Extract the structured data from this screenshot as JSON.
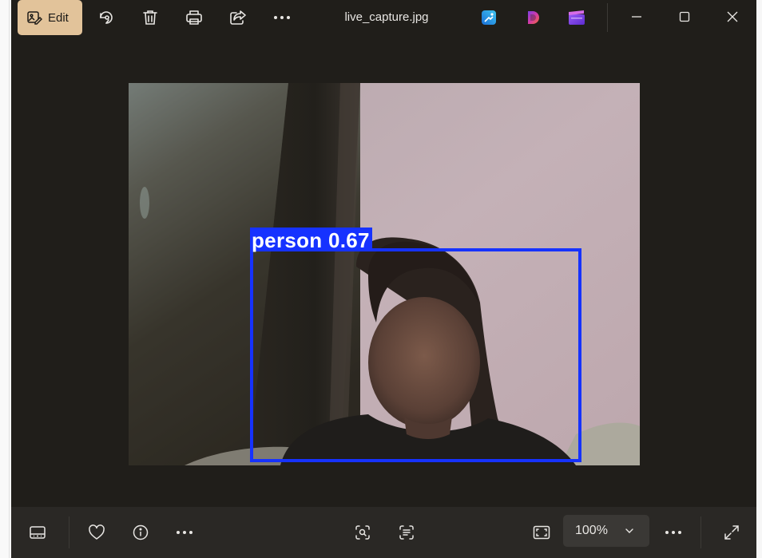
{
  "window": {
    "file_name": "live_capture.jpg"
  },
  "toolbar": {
    "edit_label": "Edit",
    "icons": [
      "edit-image-icon",
      "rotate-icon",
      "delete-icon",
      "print-icon",
      "share-icon",
      "more-icon",
      "designer-app-icon",
      "copilot-app-icon",
      "clipchamp-app-icon"
    ]
  },
  "window_controls": [
    "minimize-icon",
    "maximize-icon",
    "close-icon"
  ],
  "photo": {
    "detection": {
      "label": "person 0.67",
      "box_color": "#1632ff"
    }
  },
  "bottom_bar": {
    "zoom_value": "100%",
    "icons": [
      "filmstrip-icon",
      "favorite-icon",
      "info-icon",
      "more-icon",
      "visual-search-icon",
      "scan-text-icon",
      "fit-to-window-icon",
      "chevron-down-icon",
      "more-icon",
      "fullscreen-icon"
    ]
  },
  "colors": {
    "window_bg": "#201e1a",
    "edit_accent": "#e2c39a",
    "bottom_bar": "#2a2825"
  }
}
